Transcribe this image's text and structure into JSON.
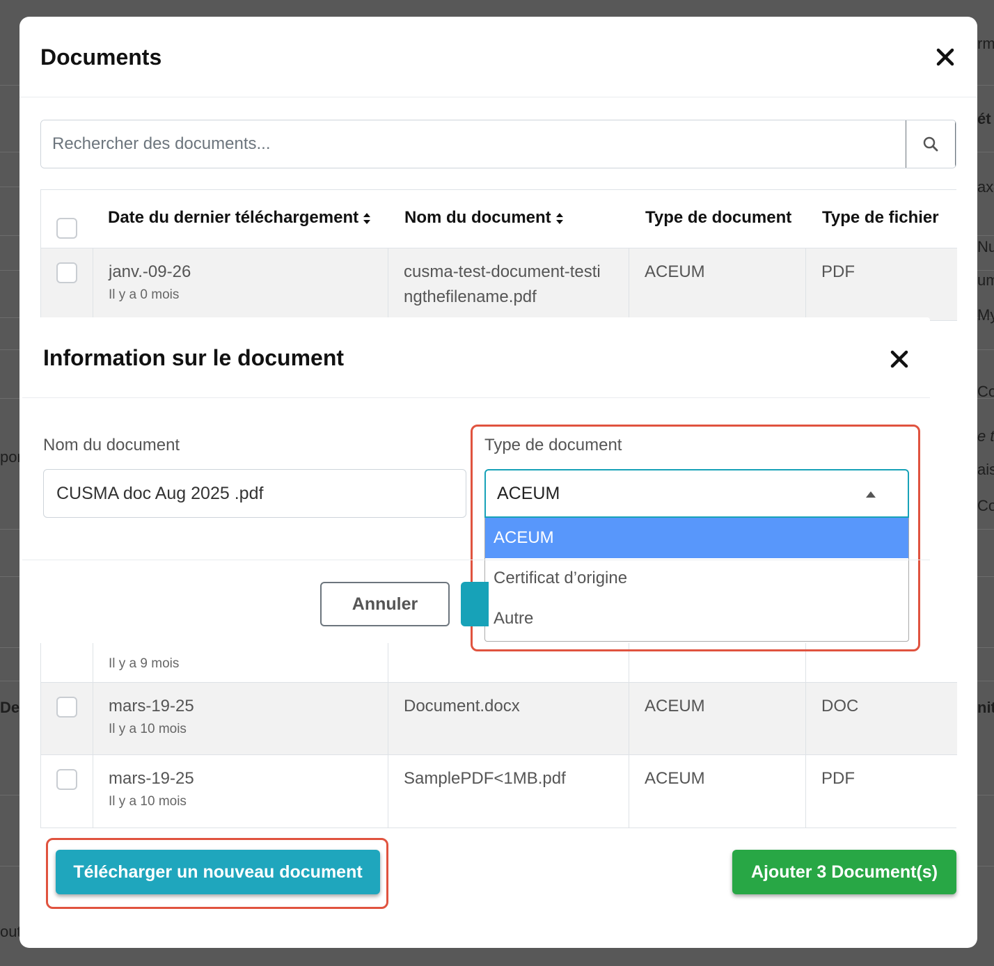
{
  "background": {
    "right_fragments": [
      "rm",
      "ét",
      "ax",
      "Nu",
      "um",
      "My",
      "Co",
      "e ti",
      "ais",
      "Co",
      "nit"
    ],
    "left_fragments": [
      "por",
      "De",
      "out"
    ]
  },
  "modal": {
    "title": "Documents",
    "close_symbol": "✕"
  },
  "search": {
    "placeholder": "Rechercher des documents..."
  },
  "table": {
    "columns": [
      "Date du dernier téléchargement",
      "Nom du document",
      "Type de document",
      "Type de fichier"
    ],
    "rows": [
      {
        "date": "janv.-09-26",
        "ago": "Il y a 0 mois",
        "name": "cusma-test-document-testingthefilename.pdf",
        "doc_type": "ACEUM",
        "file_type": "PDF"
      },
      {
        "date": "",
        "ago": "Il y a 9 mois",
        "name": "",
        "doc_type": "",
        "file_type": ""
      },
      {
        "date": "mars-19-25",
        "ago": "Il y a 10 mois",
        "name": "Document.docx",
        "doc_type": "ACEUM",
        "file_type": "DOC"
      },
      {
        "date": "mars-19-25",
        "ago": "Il y a 10 mois",
        "name": "SamplePDF<1MB.pdf",
        "doc_type": "ACEUM",
        "file_type": "PDF"
      }
    ]
  },
  "info_modal": {
    "title": "Information sur le document",
    "close_symbol": "✕",
    "name_label": "Nom du document",
    "name_value": "CUSMA doc Aug 2025 .pdf",
    "type_label": "Type de document",
    "type_value": "ACEUM",
    "type_options": [
      "ACEUM",
      "Certificat d’origine",
      "Autre"
    ],
    "cancel_label": "Annuler"
  },
  "footer": {
    "upload_label": "Télécharger un nouveau document",
    "add_label": "Ajouter 3 Document(s)"
  },
  "colors": {
    "accent_teal": "#1fa6bd",
    "success_green": "#28a745",
    "option_selected": "#5897fb",
    "highlight_red": "#e0533f"
  }
}
